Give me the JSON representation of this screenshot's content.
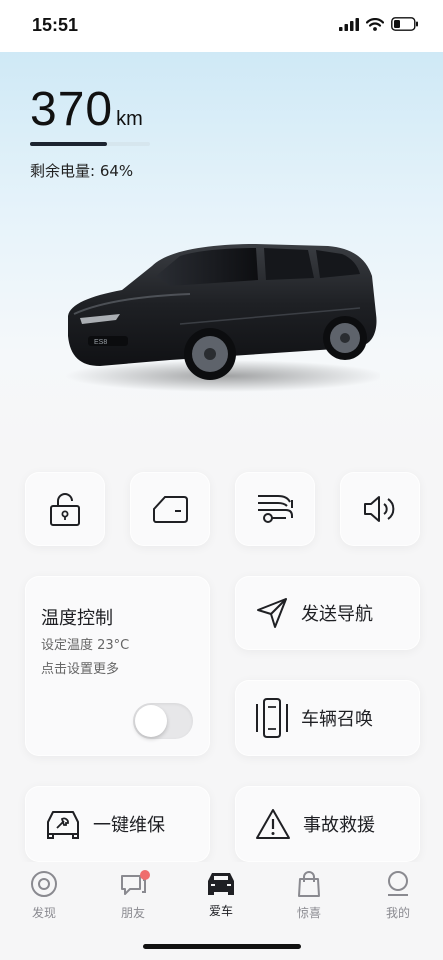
{
  "status": {
    "time": "15:51"
  },
  "range": {
    "value": "370",
    "unit": "km",
    "battery_fraction": 0.64
  },
  "battery": {
    "label": "剩余电量: 64%"
  },
  "controls": [
    {
      "name": "lock-button",
      "icon": "lock-icon"
    },
    {
      "name": "door-button",
      "icon": "car-door-icon"
    },
    {
      "name": "trunk-button",
      "icon": "trunk-icon"
    },
    {
      "name": "horn-button",
      "icon": "speaker-icon"
    }
  ],
  "climate": {
    "title": "温度控制",
    "temp": "设定温度 23°C",
    "hint": "点击设置更多",
    "enabled": false
  },
  "actions": {
    "navigation": "发送导航",
    "summon": "车辆召唤",
    "maintenance": "一键维保",
    "rescue": "事故救援"
  },
  "tabs": [
    {
      "label": "发现",
      "icon": "discover-icon"
    },
    {
      "label": "朋友",
      "icon": "chat-icon",
      "badge": true
    },
    {
      "label": "爱车",
      "icon": "car-icon",
      "active": true
    },
    {
      "label": "惊喜",
      "icon": "shopping-bag-icon"
    },
    {
      "label": "我的",
      "icon": "profile-icon"
    }
  ],
  "colors": {
    "accent": "#1c2430",
    "badge": "#ef6d6d",
    "hero_top": "#cfe9f6"
  }
}
